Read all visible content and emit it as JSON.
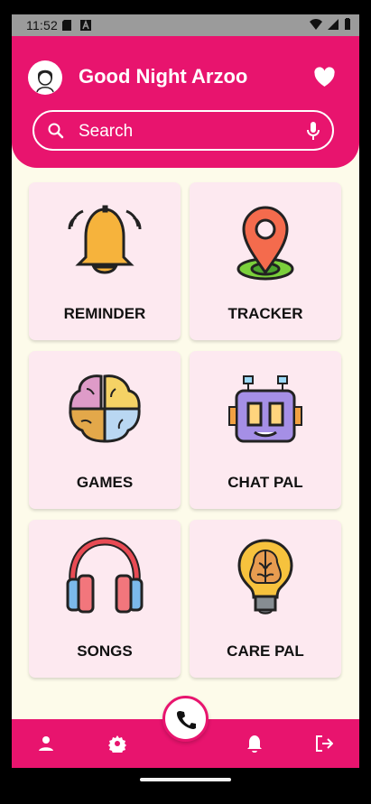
{
  "status_bar": {
    "time": "11:52",
    "left_icons": [
      "sd-card-icon",
      "notification-a-icon"
    ],
    "right_icons": [
      "wifi-icon",
      "signal-icon",
      "battery-icon"
    ]
  },
  "header": {
    "title": "Good Night Arzoo",
    "avatar_icon": "avatar-icon",
    "favorite_icon": "heart-icon"
  },
  "search": {
    "placeholder": "Search",
    "search_icon": "search-icon",
    "mic_icon": "microphone-icon"
  },
  "cards": [
    {
      "label": "REMINDER",
      "icon": "bell-icon"
    },
    {
      "label": "TRACKER",
      "icon": "map-pin-icon"
    },
    {
      "label": "GAMES",
      "icon": "brain-puzzle-icon"
    },
    {
      "label": "CHAT PAL",
      "icon": "robot-icon"
    },
    {
      "label": "SONGS",
      "icon": "headphones-icon"
    },
    {
      "label": "CARE PAL",
      "icon": "lightbulb-brain-icon"
    }
  ],
  "bottom_nav": {
    "items": [
      "profile-icon",
      "settings-icon",
      "notifications-icon",
      "logout-icon"
    ],
    "center_icon": "phone-icon"
  },
  "colors": {
    "primary": "#e8146e",
    "background": "#fdfbea",
    "card": "#fde9f0"
  }
}
